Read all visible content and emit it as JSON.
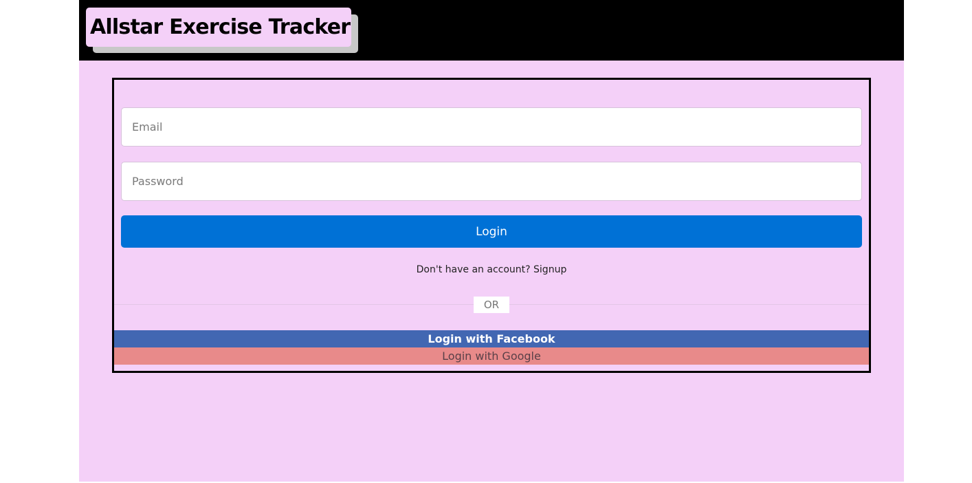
{
  "header": {
    "title": "Allstar Exercise Tracker"
  },
  "login_form": {
    "email_placeholder": "Email",
    "password_placeholder": "Password",
    "login_label": "Login",
    "signup_prompt": "Don't have an account?",
    "signup_link": "Signup",
    "or_label": "OR",
    "facebook_label": "Login with Facebook",
    "google_label": "Login with Google"
  },
  "colors": {
    "page_background": "#f4d0f8",
    "header_background": "#000000",
    "login_button": "#0071d6",
    "facebook_button": "#4267b2",
    "google_button": "#e88a8a"
  }
}
